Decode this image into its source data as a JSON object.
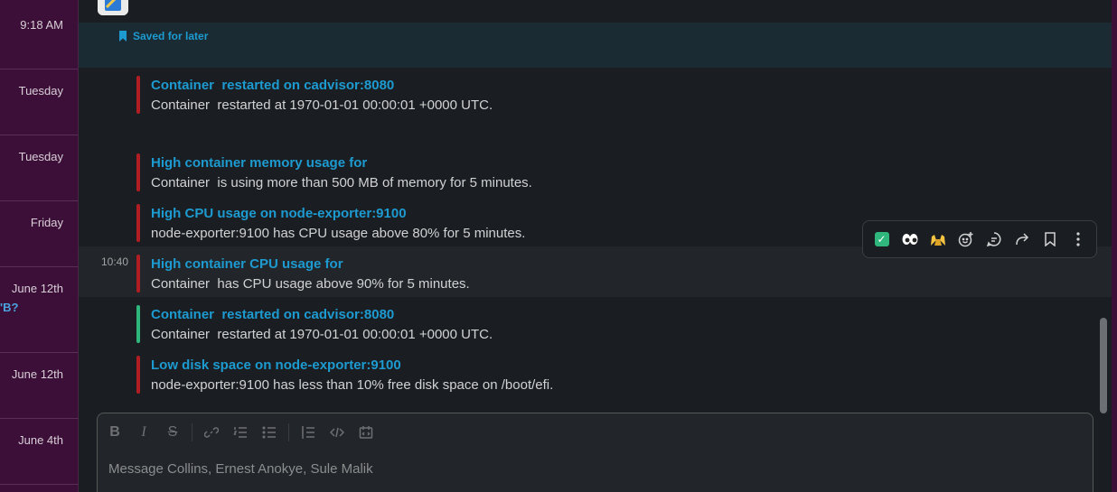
{
  "sidebar": {
    "times": [
      "9:18 AM",
      "Tuesday",
      "Tuesday",
      "Friday",
      "June 12th",
      "June 12th",
      "June 4th"
    ],
    "partial_link": "'B?"
  },
  "saved": {
    "label": "Saved for later"
  },
  "messages": [
    {
      "title": "Container  restarted on cadvisor:8080",
      "body": "Container  restarted at 1970-01-01 00:00:01 +0000 UTC.",
      "status": "firing"
    },
    {
      "title": "High container memory usage for",
      "body": "Container  is using more than 500 MB of memory for 5 minutes.",
      "status": "firing"
    },
    {
      "title": "High CPU usage on node-exporter:9100",
      "body": "node-exporter:9100 has CPU usage above 80% for 5 minutes.",
      "status": "firing"
    },
    {
      "title": "High container CPU usage for",
      "body": "Container  has CPU usage above 90% for 5 minutes.",
      "status": "firing",
      "timestamp": "10:40"
    },
    {
      "title": "Container  restarted on cadvisor:8080",
      "body": "Container  restarted at 1970-01-01 00:00:01 +0000 UTC.",
      "status": "resolved"
    },
    {
      "title": "Low disk space on node-exporter:9100",
      "body": "node-exporter:9100 has less than 10% free disk space on /boot/efi.",
      "status": "firing"
    }
  ],
  "actions": [
    {
      "icon": "check-mark-emoji",
      "glyph": "✅"
    },
    {
      "icon": "eyes-emoji",
      "glyph": "👀"
    },
    {
      "icon": "raised-hands-emoji",
      "glyph": "🙌"
    },
    {
      "icon": "add-reaction-icon",
      "glyph": "☺"
    },
    {
      "icon": "reply-thread-icon",
      "glyph": "💬"
    },
    {
      "icon": "forward-icon",
      "glyph": "↪"
    },
    {
      "icon": "bookmark-icon",
      "glyph": "🔖"
    },
    {
      "icon": "more-actions-icon",
      "glyph": "⋮"
    }
  ],
  "composer": {
    "placeholder": "Message Collins, Ernest Anokye, Sule Malik",
    "tools": [
      "B",
      "I",
      "S",
      "link",
      "ordered-list",
      "bulleted-list",
      "blockquote",
      "code",
      "code-block"
    ]
  },
  "colors": {
    "firing": "#b01e24",
    "resolved": "#2eb67d",
    "link": "#1d9bd1",
    "sidebar": "#3b0f38"
  }
}
